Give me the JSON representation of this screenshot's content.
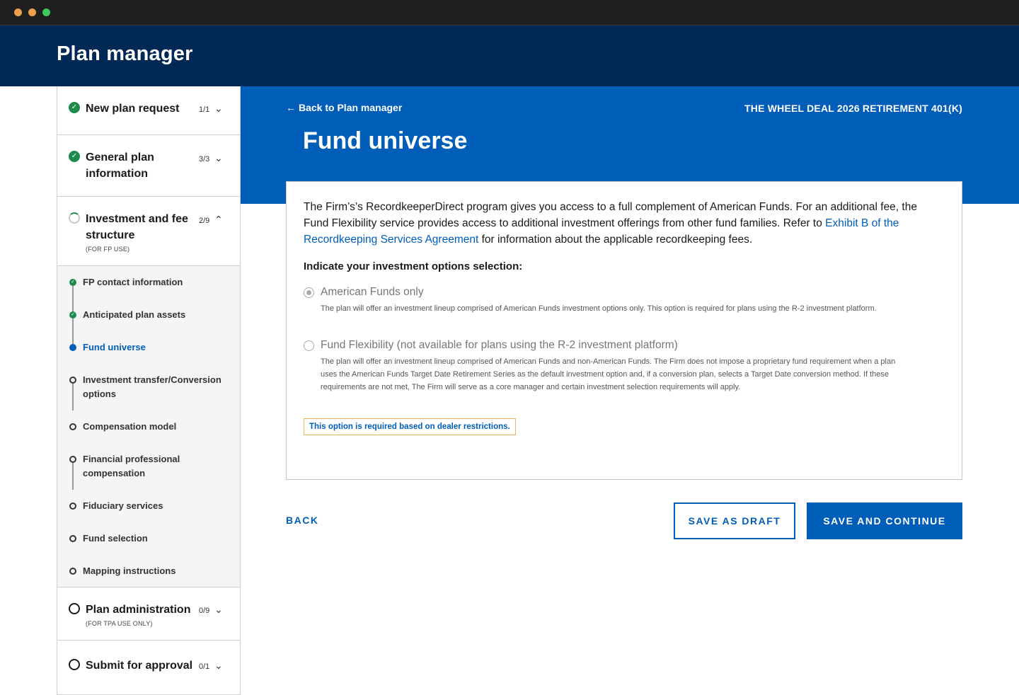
{
  "app": {
    "title": "Plan manager"
  },
  "hero": {
    "back_link": "Back to Plan manager",
    "plan_name": "THE WHEEL DEAL 2026 RETIREMENT 401(K)",
    "page_title": "Fund universe"
  },
  "sidebar": {
    "sections": [
      {
        "title": "New plan request",
        "count": "1/1",
        "status": "complete"
      },
      {
        "title": "General plan information",
        "count": "3/3",
        "status": "complete"
      },
      {
        "title": "Investment and fee structure",
        "count": "2/9",
        "status": "in-progress",
        "subtitle": "(FOR FP USE)"
      },
      {
        "title": "Plan administration",
        "count": "0/9",
        "status": "not-started",
        "subtitle": "(FOR TPA USE ONLY)"
      },
      {
        "title": "Submit for approval",
        "count": "0/1",
        "status": "not-started"
      }
    ],
    "steps": [
      {
        "label": "FP contact information",
        "status": "done"
      },
      {
        "label": "Anticipated plan assets",
        "status": "done"
      },
      {
        "label": "Fund universe",
        "status": "current"
      },
      {
        "label": "Investment transfer/Conversion options",
        "status": "todo"
      },
      {
        "label": "Compensation model",
        "status": "todo"
      },
      {
        "label": "Financial professional compensation",
        "status": "todo"
      },
      {
        "label": "Fiduciary services",
        "status": "todo"
      },
      {
        "label": "Fund selection",
        "status": "todo"
      },
      {
        "label": "Mapping instructions",
        "status": "todo"
      }
    ]
  },
  "content": {
    "intro_before": "The Firm’s’s RecordkeeperDirect program gives you access to a full complement of American Funds. For an additional fee, the Fund Flexibility service provides access to additional investment offerings from other fund families. Refer to ",
    "intro_link": "Exhibit B of the Recordkeeping Services Agreement",
    "intro_after": " for information about the applicable recordkeeping fees.",
    "question": "Indicate your investment options selection:",
    "options": [
      {
        "label": "American Funds only",
        "selected": true,
        "description": "The plan will offer an investment lineup comprised of American Funds investment options only. This option is required for plans using the R-2 investment platform."
      },
      {
        "label": "Fund Flexibility (not available for plans using the R-2 investment platform)",
        "selected": false,
        "description": "The plan will offer an investment lineup comprised of American Funds and non-American Funds. The Firm does not impose a proprietary fund requirement when a plan uses the American Funds Target Date Retirement Series as the default investment option and, if a conversion plan, selects a Target Date conversion method. If these requirements are not met, The Firm will serve as a core manager and certain investment selection requirements will apply."
      }
    ],
    "notice": "This option is required based on dealer restrictions."
  },
  "actions": {
    "back": "BACK",
    "save_draft": "SAVE AS DRAFT",
    "save_continue": "SAVE AND CONTINUE"
  },
  "colors": {
    "header_bg": "#002855",
    "primary": "#005eb8",
    "success": "#1e8a4c",
    "notice_border": "#f0b25a"
  }
}
